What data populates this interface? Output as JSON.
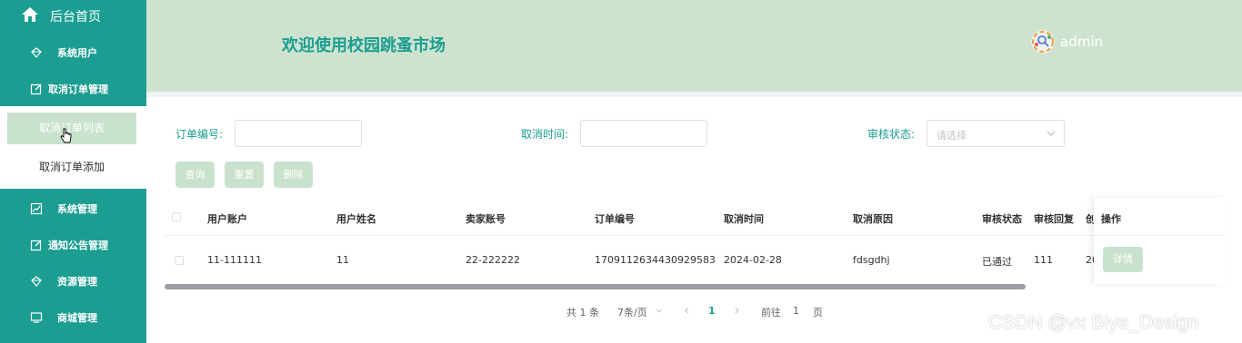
{
  "sidebar": {
    "home_label": "后台首页",
    "menu": {
      "system_users": "系统用户",
      "cancel_order_mgmt": "取消订单管理",
      "system_mgmt": "系统管理",
      "notice_mgmt": "通知公告管理",
      "resource_mgmt": "资源管理",
      "mall_mgmt": "商城管理"
    },
    "submenu": {
      "cancel_order_list": "取消订单列表",
      "cancel_order_add": "取消订单添加"
    }
  },
  "header": {
    "welcome": "欢迎使用校园跳蚤市场",
    "username": "admin"
  },
  "search": {
    "order_no_label": "订单编号:",
    "cancel_time_label": "取消时间:",
    "review_status_label": "审核状态:",
    "review_status_placeholder": "请选择"
  },
  "buttons": {
    "query": "查询",
    "reset": "重置",
    "delete": "删除",
    "detail": "详情"
  },
  "table": {
    "headers": {
      "user_account": "用户账户",
      "user_name": "用户姓名",
      "seller_account": "卖家账号",
      "order_no": "订单编号",
      "cancel_time": "取消时间",
      "cancel_reason": "取消原因",
      "review_status": "审核状态",
      "review_reply": "审核回复",
      "created_partial": "创",
      "actions": "操作"
    },
    "rows": [
      {
        "user_account": "11-111111",
        "user_name": "11",
        "seller_account": "22-222222",
        "order_no": "1709112634430929583",
        "cancel_time": "2024-02-28",
        "cancel_reason": "fdsgdhj",
        "review_status": "已通过",
        "review_reply": "111",
        "created_partial": "20"
      }
    ]
  },
  "pagination": {
    "total": "共 1 条",
    "page_size": "7条/页",
    "current_page": "1",
    "goto_label": "前往",
    "goto_value": "1",
    "page_suffix": "页"
  },
  "watermark": "CSDN @vx Biye_Design",
  "colors": {
    "sidebar": "#1b9e91",
    "header": "#cde3cf",
    "button": "#c9e2cd",
    "accent": "#1b9e91"
  }
}
